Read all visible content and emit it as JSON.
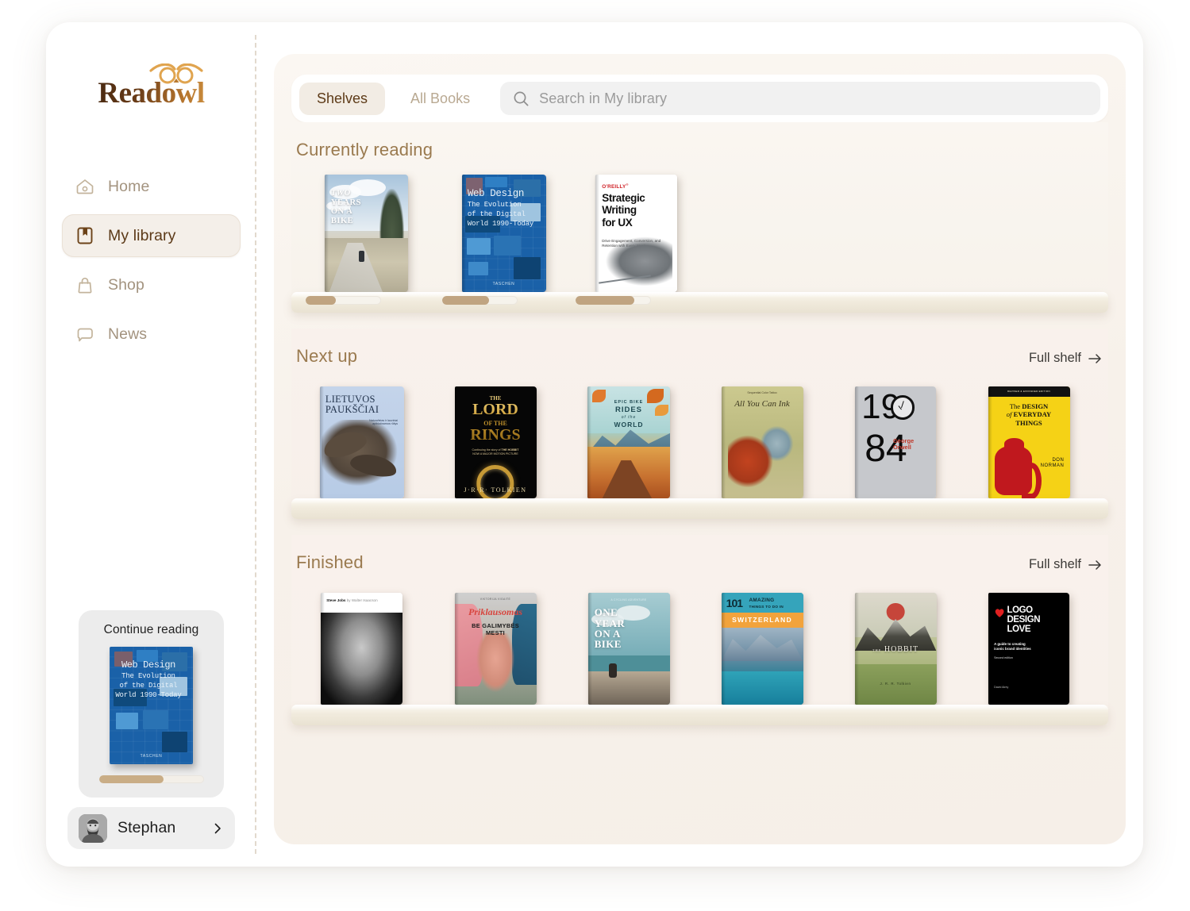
{
  "brand": {
    "name": "Readowl",
    "logo_icon": "owl-face-icon",
    "accent": "#8a5a22",
    "accent_light": "#c98b3c"
  },
  "sidebar": {
    "items": [
      {
        "label": "Home",
        "icon": "home-icon",
        "active": false
      },
      {
        "label": "My library",
        "icon": "book-icon",
        "active": true
      },
      {
        "label": "Shop",
        "icon": "bag-icon",
        "active": false
      },
      {
        "label": "News",
        "icon": "speech-bubble-icon",
        "active": false
      }
    ],
    "continue_reading": {
      "title": "Continue reading",
      "book": {
        "title": "Web Design",
        "subtitle": "The Evolution of the Digital World 1990-Today",
        "publisher": "TASCHEN"
      },
      "progress_percent": 62
    },
    "profile": {
      "name": "Stephan",
      "avatar": "user-avatar",
      "chevron": "chevron-right-icon"
    }
  },
  "toolbar": {
    "tabs": [
      {
        "label": "Shelves",
        "active": true
      },
      {
        "label": "All Books",
        "active": false
      }
    ],
    "search": {
      "placeholder": "Search in My library",
      "value": "",
      "icon": "search-icon"
    }
  },
  "shelves": [
    {
      "title": "Currently reading",
      "full_shelf_label": null,
      "books": [
        {
          "title": "Two Years on a Bike",
          "art": "twoyears",
          "progress_percent": 40
        },
        {
          "title": "Web Design",
          "subtitle": "The Evolution of the Digital World 1990-Today",
          "art": "webdesign",
          "progress_percent": 62
        },
        {
          "title": "Strategic Writing for UX",
          "subtitle": "Drive Engagement, Conversion, and Retention with Every Word",
          "publisher": "O'REILLY",
          "art": "oreilly",
          "progress_percent": 78
        }
      ]
    },
    {
      "title": "Next up",
      "full_shelf_label": "Full shelf",
      "books": [
        {
          "title": "Lietuvos Paukščiai",
          "art": "lietuvos"
        },
        {
          "title": "The Lord of the Rings",
          "author": "J·R·R· TOLKIEN",
          "tagline": "Continuing the story of THE HOBBIT NOW A MAJOR MOTION PICTURE",
          "art": "lotr"
        },
        {
          "title": "Epic Bike Rides of the World",
          "art": "epic"
        },
        {
          "title": "All You Can Ink",
          "author": "Sequential Color Tattoo",
          "art": "ink"
        },
        {
          "title": "1984",
          "author": "George Orwell",
          "art": "n1984"
        },
        {
          "title": "The Design of Everyday Things",
          "author": "DON NORMAN",
          "edition": "REVISED & EXPANDED EDITION",
          "art": "doet"
        }
      ]
    },
    {
      "title": "Finished",
      "full_shelf_label": "Full shelf",
      "books": [
        {
          "title": "Steve Jobs",
          "author": "by Walter Isaacson",
          "art": "jobs"
        },
        {
          "title": "Priklausomas",
          "subtitle": "BE GALIMYBĖS MESTI",
          "author": "VIKTORIJA VIGAITĖ",
          "art": "prik"
        },
        {
          "title": "One Year on a Bike",
          "art": "oneyear"
        },
        {
          "title": "101 Amazing Things to do in Switzerland",
          "art": "swiss"
        },
        {
          "title": "The Hobbit",
          "author": "J. R. R. Tolkien",
          "art": "hobbit"
        },
        {
          "title": "Logo Design Love",
          "subtitle": "A guide to creating iconic brand identities",
          "edition": "Second edition",
          "author": "David Airey",
          "art": "logo"
        }
      ]
    }
  ],
  "book_text": {
    "twoyears": {
      "l1": "TWO",
      "l2": "YEARS",
      "l3": "ON A",
      "l4": "BIKE"
    },
    "webdesign": {
      "l1": "Web Design",
      "l2": "The Evolution",
      "l3": "of the Digital",
      "l4": "World 1990-Today",
      "pub": "TASCHEN"
    },
    "oreilly": {
      "brand": "O'REILLY",
      "l1": "Strategic",
      "l2": "Writing",
      "l3": "for UX",
      "sub": "Drive Engagement, Conversion, and Retention with Every Word"
    },
    "lietuvos": {
      "l1": "LIETUVOS",
      "l2": "PAUKŠČIAI"
    },
    "lotr": {
      "l1": "THE",
      "l2": "LORD",
      "l3": "OF THE",
      "l4": "RINGS",
      "tag": "Continuing the story of THE HOBBIT",
      "tag2": "NOW A MAJOR MOTION PICTURE",
      "auth": "J·R·R· TOLKIEN"
    },
    "epic": {
      "l1": "EPIC BIKE",
      "l2": "RIDES",
      "l3": "of the",
      "l4": "WORLD"
    },
    "ink": {
      "sup": "Sequential Color Tattoo",
      "ttl": "All You Can Ink"
    },
    "n1984": {
      "d1": "19",
      "d2": "84",
      "a1": "George",
      "a2": "Orwell"
    },
    "doet": {
      "bar": "REVISED & EXPANDED EDITION",
      "l1": "The DESIGN",
      "l2": "of EVERYDAY",
      "l3": "THINGS",
      "a1": "DON",
      "a2": "NORMAN"
    },
    "jobs": {
      "name": "Steve Jobs",
      "by": " by Walter Isaacson"
    },
    "prik": {
      "author": "VIKTORIJA VIGAITĖ",
      "script": "Priklausomas",
      "s1": "BE GALIMYBĖS",
      "s2": "MESTI"
    },
    "oneyear": {
      "top": "A CYCLING ADVENTURE",
      "l1": "ONE",
      "l2": "YEAR",
      "l3": "ON A",
      "l4": "BIKE"
    },
    "swiss": {
      "n": "101",
      "a1": "AMAZING",
      "a2": "THINGS TO DO IN",
      "ch": "SWITZERLAND"
    },
    "hobbit": {
      "ttl": "THE HOBBIT",
      "auth": "J. R. R. Tolkien"
    },
    "logo": {
      "l1": "LOGO",
      "l2": "DESIGN",
      "l3": "LOVE",
      "s1": "A guide to creating",
      "s2": "iconic brand identities",
      "ed": "Second edition",
      "auth": "David Airey"
    }
  }
}
